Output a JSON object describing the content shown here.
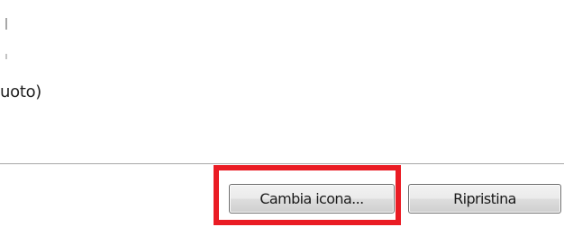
{
  "window": {
    "partial_text": "uoto)"
  },
  "buttons": {
    "change_icon_label": "Cambia icona...",
    "restore_label": "Ripristina"
  },
  "colors": {
    "highlight": "#ea1c24",
    "separator": "#a7a7a7",
    "background": "#ffffff"
  }
}
